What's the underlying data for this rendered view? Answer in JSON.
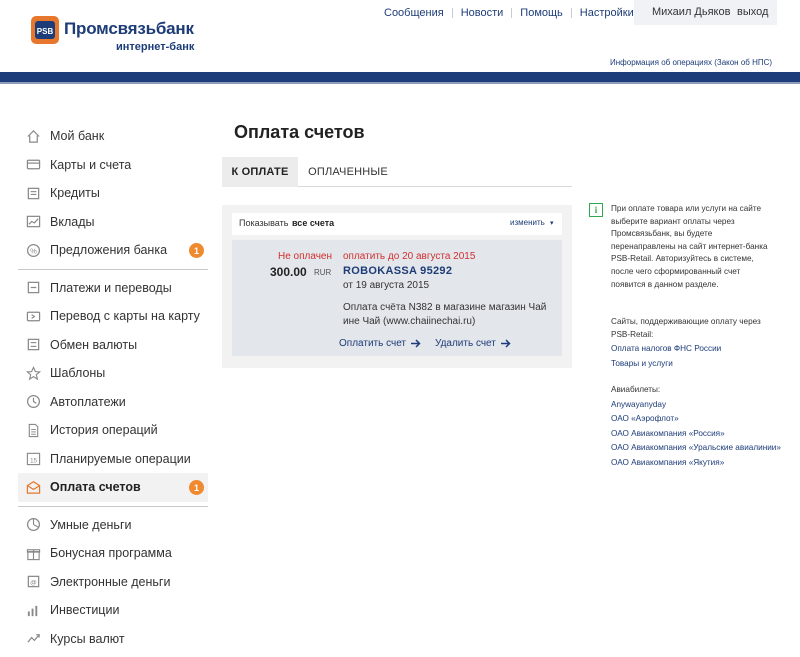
{
  "header": {
    "logo_name": "Промсвязьбанк",
    "logo_sub": "интернет-банк",
    "nav": [
      "Сообщения",
      "Новости",
      "Помощь",
      "Настройки"
    ],
    "user_name": "Михаил Дьяков",
    "logout": "выход",
    "law_link": "Информация об операциях (Закон об НПС)"
  },
  "colors": {
    "brand_blue": "#1d3c78",
    "badge_orange": "#ef8a2f",
    "status_red": "#d03030",
    "info_green": "#2fa84f"
  },
  "sidebar": {
    "group1": [
      {
        "label": "Мой банк",
        "icon": "home-icon"
      },
      {
        "label": "Карты и счета",
        "icon": "card-icon"
      },
      {
        "label": "Кредиты",
        "icon": "credit-icon"
      },
      {
        "label": "Вклады",
        "icon": "deposit-chart-icon"
      },
      {
        "label": "Предложения банка",
        "icon": "percent-icon",
        "badge": "1"
      }
    ],
    "group2": [
      {
        "label": "Платежи и переводы",
        "icon": "payment-icon"
      },
      {
        "label": "Перевод с карты на карту",
        "icon": "card-transfer-icon"
      },
      {
        "label": "Обмен валюты",
        "icon": "exchange-icon"
      },
      {
        "label": "Шаблоны",
        "icon": "star-icon"
      },
      {
        "label": "Автоплатежи",
        "icon": "clock-icon"
      },
      {
        "label": "История операций",
        "icon": "history-doc-icon"
      },
      {
        "label": "Планируемые операции",
        "icon": "calendar-icon"
      },
      {
        "label": "Оплата счетов",
        "icon": "envelope-icon",
        "badge": "1"
      }
    ],
    "group3": [
      {
        "label": "Умные деньги",
        "icon": "pie-chart-icon"
      },
      {
        "label": "Бонусная программа",
        "icon": "gift-icon"
      },
      {
        "label": "Электронные деньги",
        "icon": "e-money-icon"
      },
      {
        "label": "Инвестиции",
        "icon": "investment-icon"
      },
      {
        "label": "Курсы валют",
        "icon": "rates-icon"
      }
    ]
  },
  "main": {
    "title": "Оплата счетов",
    "tabs": [
      "К ОПЛАТЕ",
      "ОПЛАЧЕННЫЕ"
    ],
    "filter": {
      "label": "Показывать",
      "value": "все счета",
      "change": "изменить"
    },
    "bill": {
      "status": "Не оплачен",
      "amount": "300.00",
      "currency": "RUR",
      "due": "оплатить до 20 августа 2015",
      "merchant": "ROBOKASSA 95292",
      "date": "от 19 августа 2015",
      "description": "Оплата счёта N382 в магазине магазин Чай ине Чай (www.chaiinechai.ru)",
      "pay_action": "Оплатить счет",
      "delete_action": "Удалить счет"
    }
  },
  "info": {
    "intro": "При оплате товара или услуги на сайте выберите вариант оплаты через Промсвязьбанк, вы будете перенаправлены на сайт интернет-банка PSB-Retail. Авторизуйтесь в системе, после чего сформированный счет появится в данном разделе.",
    "sites_title": "Сайты, поддерживающие оплату через PSB-Retail:",
    "sites": [
      "Оплата налогов ФНС России",
      "Товары и услуги"
    ],
    "avia_title": "Авиабилеты:",
    "avia": [
      "Anywayanyday",
      "ОАО «Аэрофлот»",
      "ОАО Авиакомпания «Россия»",
      "ОАО Авиакомпания «Уральские авиалинии»",
      "ОАО Авиакомпания «Якутия»"
    ]
  }
}
